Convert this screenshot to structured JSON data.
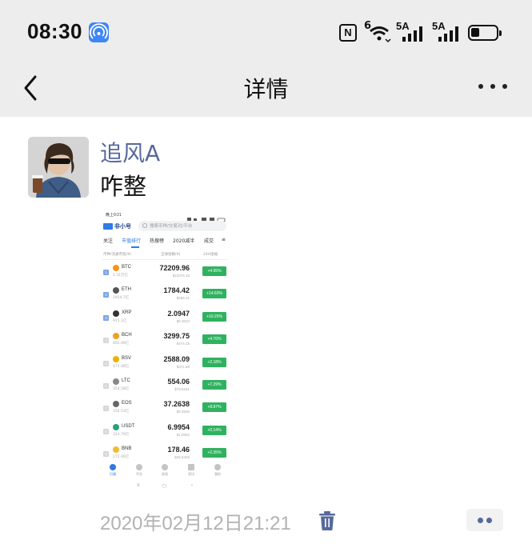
{
  "status_bar": {
    "time": "08:30",
    "nfc_label": "N",
    "wifi_label": "6",
    "signal1_label": "5A",
    "signal2_label": "5A",
    "battery_level": 0.35,
    "icons": [
      "hotspot-icon",
      "nfc-icon",
      "wifi-icon",
      "signal-icon",
      "battery-icon"
    ]
  },
  "nav": {
    "title": "详情",
    "back_icon": "chevron-left-icon",
    "more_icon": "more-dots-icon"
  },
  "post": {
    "username": "追风A",
    "text": "咋整",
    "timestamp": "2020年02月12日21:21",
    "delete_icon": "trash-icon",
    "actions_icon": "comment-dots-icon",
    "accent_color": "#57699b"
  },
  "screenshot": {
    "status_time": "晚上9:21",
    "app_name": "非小号",
    "search_placeholder": "搜索币种/交易对/平台",
    "tabs": [
      "关注",
      "市值排行",
      "热搜榜",
      "2020减半",
      "成交"
    ],
    "active_tab": "市值排行",
    "col_headers": [
      "币种/流通市值(¥)",
      "全球指数(¥)",
      "24H涨幅"
    ],
    "rows": [
      {
        "rank": "1",
        "symbol": "BTC",
        "cap": "1.31万亿",
        "price": "72209.96",
        "usd": "$10376.18",
        "change": "+4.95%",
        "coin_color": "#f7931a"
      },
      {
        "rank": "2",
        "symbol": "ETH",
        "cap": "1954.7亿",
        "price": "1784.42",
        "usd": "$256.41",
        "change": "+14.60%",
        "coin_color": "#555555"
      },
      {
        "rank": "3",
        "symbol": "XRP",
        "cap": "915.1亿",
        "price": "2.0947",
        "usd": "$0.3010",
        "change": "+10.25%",
        "coin_color": "#333333"
      },
      {
        "rank": "4",
        "symbol": "BCH",
        "cap": "602.99亿",
        "price": "3299.75",
        "usd": "$474.15",
        "change": "+4.76%",
        "coin_color": "#f0a020"
      },
      {
        "rank": "5",
        "symbol": "BSV",
        "cap": "472.48亿",
        "price": "2588.09",
        "usd": "$371.89",
        "change": "+2.18%",
        "coin_color": "#eab300"
      },
      {
        "rank": "6",
        "symbol": "LTC",
        "cap": "354.58亿",
        "price": "554.06",
        "usd": "$79.6151",
        "change": "+7.29%",
        "coin_color": "#888888"
      },
      {
        "rank": "7",
        "symbol": "EOS",
        "cap": "354.53亿",
        "price": "37.2638",
        "usd": "$5.3546",
        "change": "+8.87%",
        "coin_color": "#666666"
      },
      {
        "rank": "8",
        "symbol": "USDT",
        "cap": "324.79亿",
        "price": "6.9954",
        "usd": "$1.0052",
        "change": "+0.14%",
        "coin_color": "#26a17b"
      },
      {
        "rank": "9",
        "symbol": "BNB",
        "cap": "272.46亿",
        "price": "178.46",
        "usd": "$25.6449",
        "change": "+2.35%",
        "coin_color": "#f3ba2f"
      }
    ],
    "bottom_tabs": [
      "行情",
      "平台",
      "发现",
      "资讯",
      "我的"
    ],
    "sys_nav": [
      "≡",
      "◻",
      "‹"
    ],
    "change_color": "#2fb25f"
  }
}
